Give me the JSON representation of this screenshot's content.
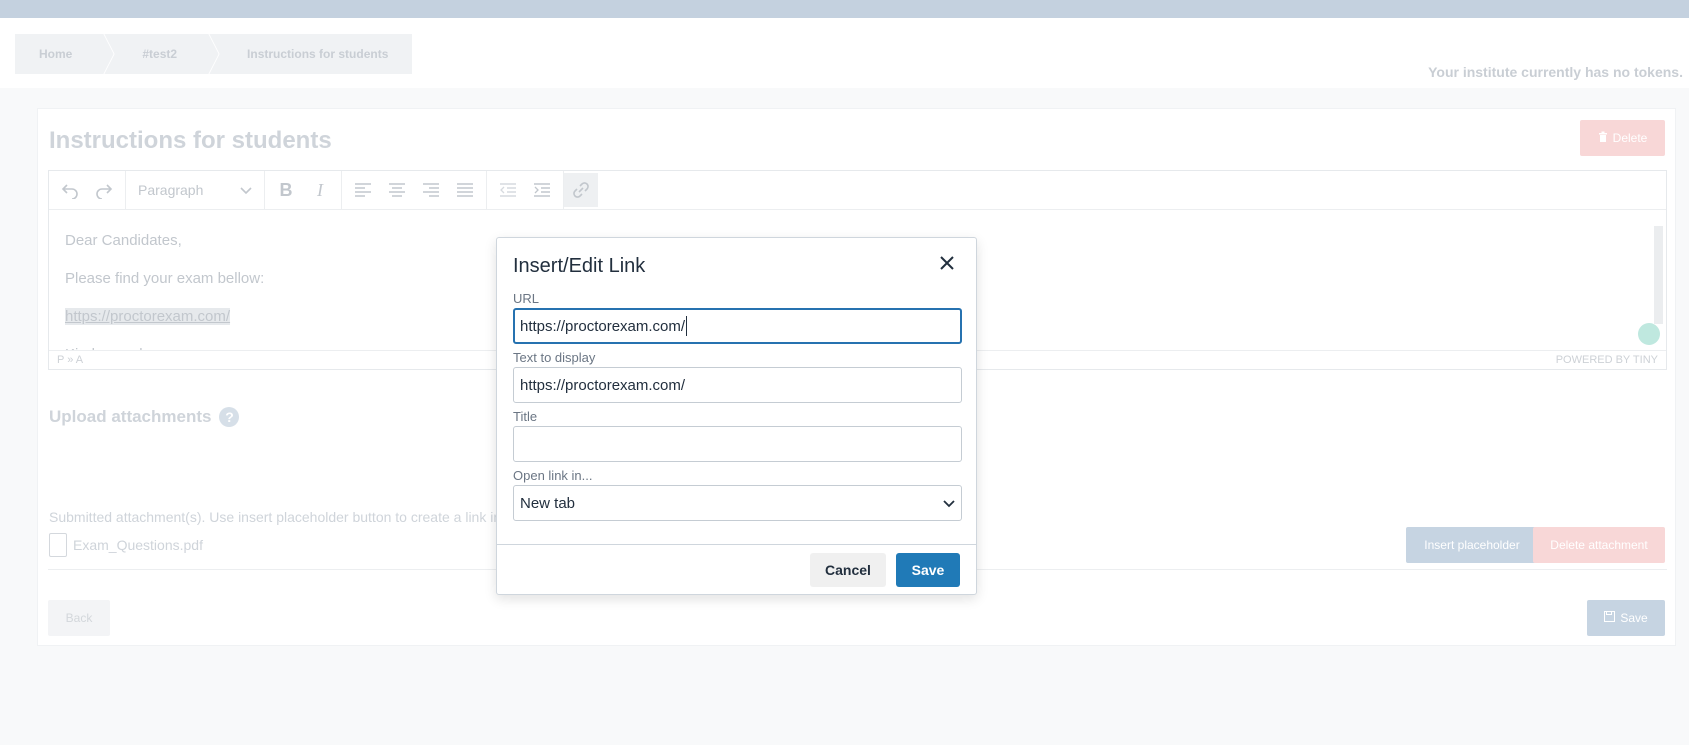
{
  "breadcrumb": [
    "Home",
    "#test2",
    "Instructions for students"
  ],
  "tokens_message": "Your institute currently has no tokens.",
  "page": {
    "title": "Instructions for students",
    "delete_label": "Delete"
  },
  "editor": {
    "block_format": "Paragraph",
    "lines": [
      "Dear Candidates,",
      "Please find your exam bellow:",
      "https://proctorexam.com/",
      "Kind regards"
    ],
    "status_path": "P » A",
    "powered_by": "POWERED BY TINY"
  },
  "attachments": {
    "title": "Upload attachments",
    "help": "?",
    "submitted_text": "Submitted attachment(s). Use insert placeholder button to create a link in",
    "file_name": "Exam_Questions.pdf",
    "insert_placeholder_label": "Insert placeholder",
    "delete_attachment_label": "Delete attachment"
  },
  "footer": {
    "back_label": "Back",
    "save_label": "Save"
  },
  "dialog": {
    "title": "Insert/Edit Link",
    "url_label": "URL",
    "url_value": "https://proctorexam.com/",
    "text_label": "Text to display",
    "text_value": "https://proctorexam.com/",
    "title_label": "Title",
    "title_value": "",
    "open_in_label": "Open link in...",
    "open_in_value": "New tab",
    "cancel_label": "Cancel",
    "save_label": "Save"
  },
  "colors": {
    "primary": "#207ab7",
    "focus_border": "#2672b0",
    "danger_faded": "#f8d7d7",
    "topbar": "#c4d1df"
  }
}
